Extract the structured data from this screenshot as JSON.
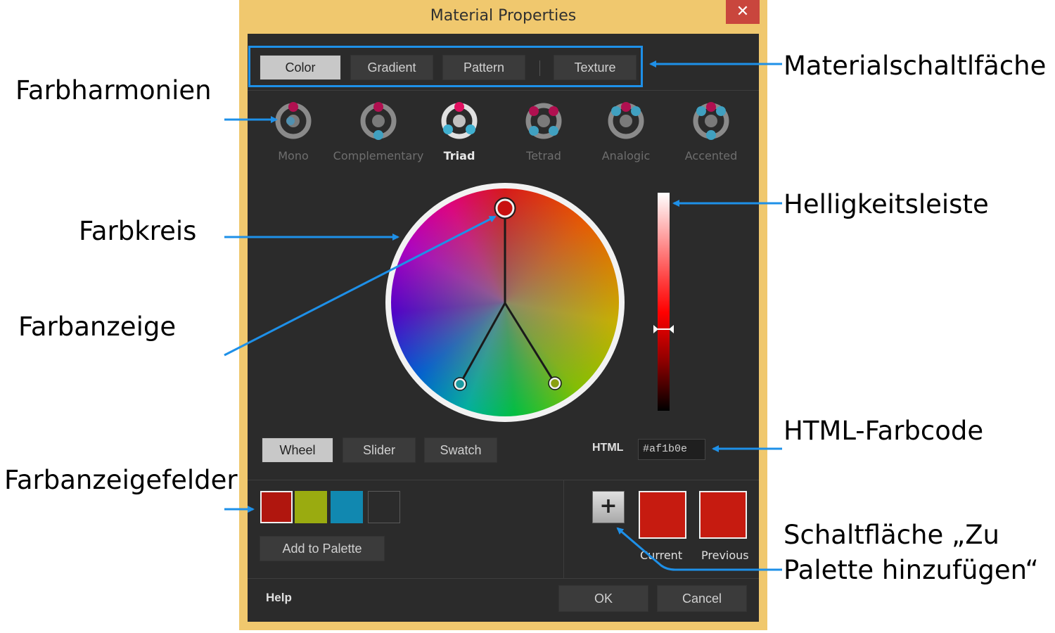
{
  "window": {
    "title": "Material Properties",
    "close_glyph": "✕"
  },
  "material_tabs": [
    "Color",
    "Gradient",
    "Pattern",
    "Texture"
  ],
  "harmonies": [
    "Mono",
    "Complementary",
    "Triad",
    "Tetrad",
    "Analogic",
    "Accented"
  ],
  "selected_harmony": "Triad",
  "view_tabs": [
    "Wheel",
    "Slider",
    "Swatch"
  ],
  "html_code": {
    "label": "HTML",
    "value": "#af1b0e"
  },
  "swatch_colors": [
    "#b0160e",
    "#9aab10",
    "#1188b0",
    "#2b2b2b"
  ],
  "add_to_palette_label": "Add to Palette",
  "add_button_glyph": "+",
  "current": {
    "label": "Current",
    "color": "#c61b10"
  },
  "previous": {
    "label": "Previous",
    "color": "#c61b10"
  },
  "footer": {
    "help": "Help",
    "ok": "OK",
    "cancel": "Cancel"
  },
  "annotations": {
    "farbharmonien": "Farbharmonien",
    "farbkreis": "Farbkreis",
    "farbanzeige": "Farbanzeige",
    "farbanzeigefelder": "Farbanzeigefelder",
    "materialschaltflaeche": "Materialschaltlfäche",
    "helligkeitsleiste": "Helligkeitsleiste",
    "html_farbcode": "HTML-Farbcode",
    "zu_palette_line1": "Schaltfläche „Zu",
    "zu_palette_line2": "Palette hinzufügen“"
  },
  "colors": {
    "accent_blue": "#1e90e8",
    "dialog_bg": "#2b2b2b",
    "frame": "#f0c86e",
    "close_red": "#c9463d"
  }
}
